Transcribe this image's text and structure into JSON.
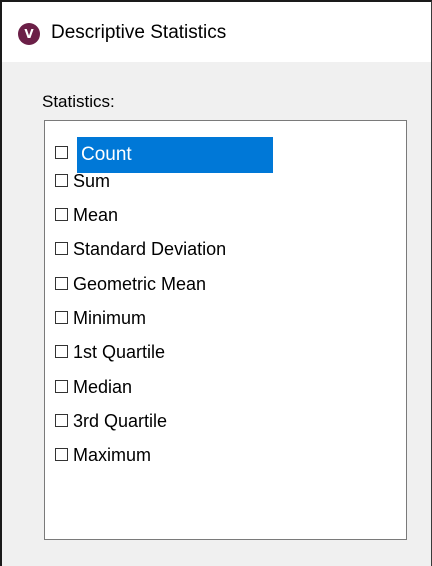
{
  "window": {
    "title": "Descriptive Statistics",
    "icon": "v-app-icon",
    "icon_glyph": "V"
  },
  "statistics": {
    "label": "Statistics:",
    "items": [
      {
        "label": "Count",
        "checked": false,
        "selected": true
      },
      {
        "label": "Sum",
        "checked": false,
        "selected": false
      },
      {
        "label": "Mean",
        "checked": false,
        "selected": false
      },
      {
        "label": "Standard Deviation",
        "checked": false,
        "selected": false
      },
      {
        "label": "Geometric Mean",
        "checked": false,
        "selected": false
      },
      {
        "label": "Minimum",
        "checked": false,
        "selected": false
      },
      {
        "label": "1st Quartile",
        "checked": false,
        "selected": false
      },
      {
        "label": "Median",
        "checked": false,
        "selected": false
      },
      {
        "label": "3rd Quartile",
        "checked": false,
        "selected": false
      },
      {
        "label": "Maximum",
        "checked": false,
        "selected": false
      }
    ]
  },
  "colors": {
    "selection": "#0078d7",
    "app_icon": "#6b1f47"
  }
}
